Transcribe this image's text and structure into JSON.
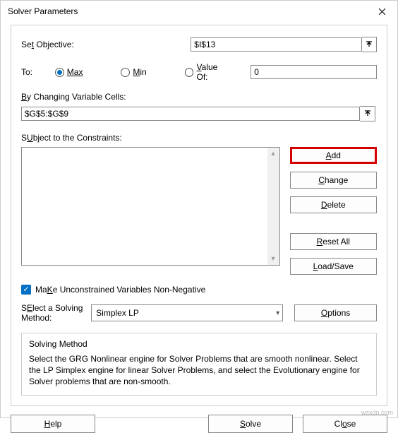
{
  "window": {
    "title": "Solver Parameters"
  },
  "labels": {
    "set_objective_u": "t",
    "set_objective_pre": "Se",
    "set_objective_post": " Objective:",
    "to": "To:",
    "max": "Max",
    "min": "Min",
    "value_of_u": "V",
    "value_of_rest": "alue Of:",
    "by_u": "B",
    "by_rest": "y Changing Variable Cells:",
    "subject_u": "U",
    "subject_pre": "S",
    "subject_post": "bject to the Constraints:",
    "make_u": "K",
    "make_pre": "Ma",
    "make_post": "e Unconstrained Variables Non-Negative",
    "solving_method_u": "E",
    "solving_method_pre": "S",
    "solving_method_post": "lect a Solving Method:",
    "solving_method_title": "Solving Method",
    "solving_method_desc": "Select the GRG Nonlinear engine for Solver Problems that are smooth nonlinear. Select the LP Simplex engine for linear Solver Problems, and select the Evolutionary engine for Solver problems that are non-smooth."
  },
  "values": {
    "objective": "$I$13",
    "value_of": "0",
    "cells": "$G$5:$G$9",
    "method": "Simplex LP"
  },
  "buttons": {
    "add_u": "A",
    "add_rest": "dd",
    "change_u": "C",
    "change_rest": "hange",
    "delete_u": "D",
    "delete_rest": "elete",
    "reset_u": "R",
    "reset_rest": "eset All",
    "load_u": "L",
    "load_rest": "oad/Save",
    "options_u": "O",
    "options_rest": "ptions",
    "help_u": "H",
    "help_rest": "elp",
    "solve_u": "S",
    "solve_rest": "olve",
    "close_rest": "Cl",
    "close_u": "o",
    "close_post": "se"
  },
  "watermark": "wsxdn.com"
}
